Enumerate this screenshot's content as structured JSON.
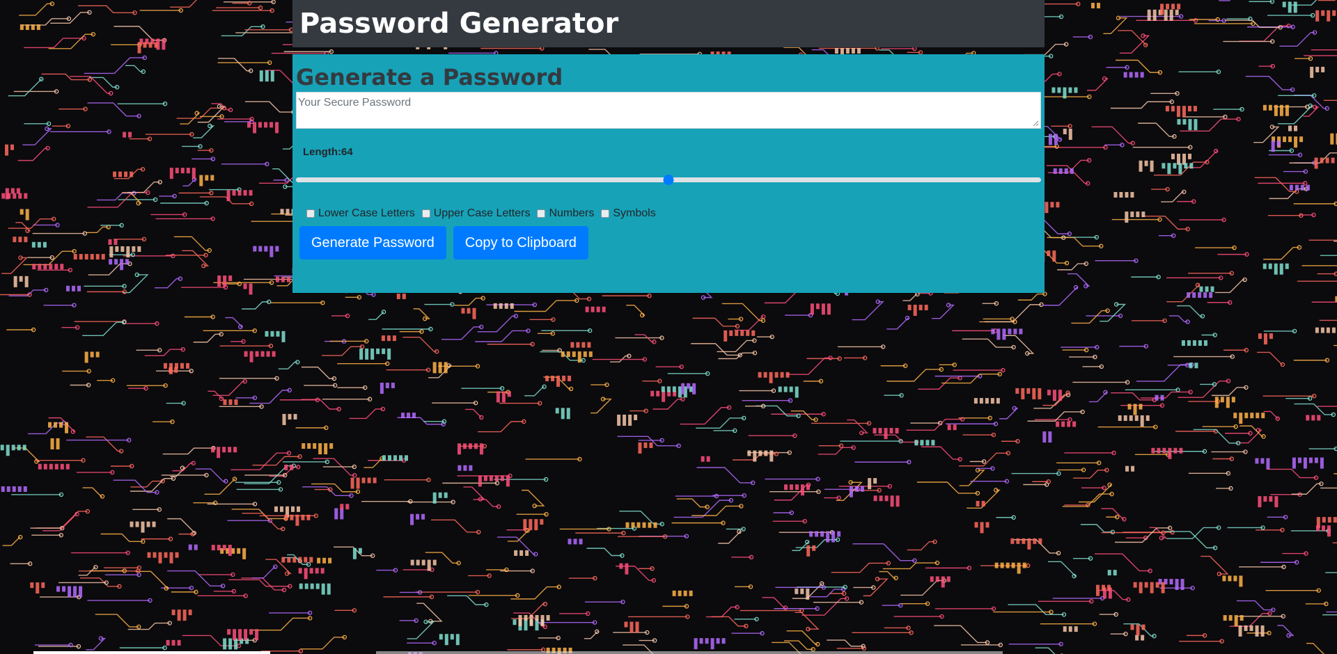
{
  "header": {
    "title": "Password Generator"
  },
  "generator": {
    "heading": "Generate a Password",
    "password_placeholder": "Your Secure Password",
    "length_label": "Length:64",
    "length_value": 64,
    "length_fraction": 0.5,
    "options": [
      {
        "label": "Lower Case Letters",
        "checked": false
      },
      {
        "label": "Upper Case Letters",
        "checked": false
      },
      {
        "label": "Numbers",
        "checked": false
      },
      {
        "label": "Symbols",
        "checked": false
      }
    ],
    "generate_label": "Generate Password",
    "copy_label": "Copy to Clipboard"
  },
  "colors": {
    "header_bg": "#343a40",
    "card_bg": "#17a2b8",
    "button_bg": "#007bff",
    "circuit_lines": [
      "#ff4f7b",
      "#ffb347",
      "#7fe0d0",
      "#b36bff",
      "#ff6a5c",
      "#f7c7a8"
    ]
  },
  "icons": {
    "background": "circuit-board-pattern",
    "textarea_grip": "resize-grip-icon"
  }
}
